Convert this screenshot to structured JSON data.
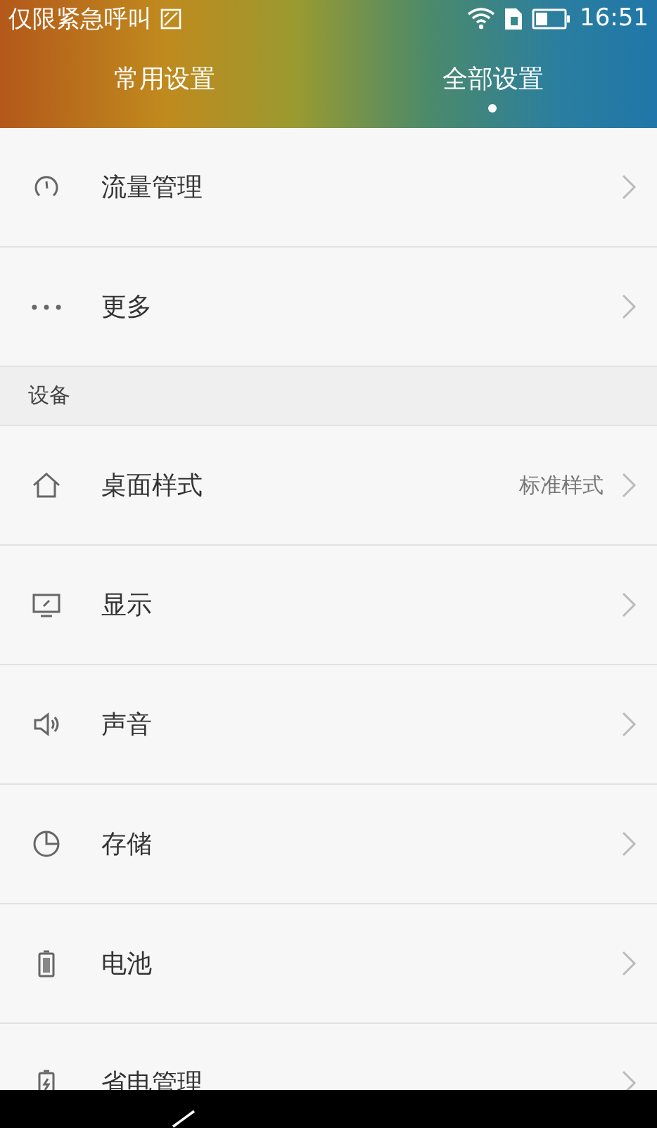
{
  "status_bar": {
    "carrier": "仅限紧急呼叫",
    "time": "16:51"
  },
  "tabs": [
    {
      "label": "常用设置",
      "selected": false
    },
    {
      "label": "全部设置",
      "selected": true
    }
  ],
  "items": [
    {
      "kind": "entry",
      "label": "流量管理"
    },
    {
      "kind": "entry",
      "label": "更多"
    },
    {
      "kind": "section",
      "label": "设备"
    },
    {
      "kind": "entry",
      "label": "桌面样式",
      "value": "标准样式"
    },
    {
      "kind": "entry",
      "label": "显示"
    },
    {
      "kind": "entry",
      "label": "声音"
    },
    {
      "kind": "entry",
      "label": "存储"
    },
    {
      "kind": "entry",
      "label": "电池"
    },
    {
      "kind": "entry",
      "label": "省电管理"
    }
  ]
}
